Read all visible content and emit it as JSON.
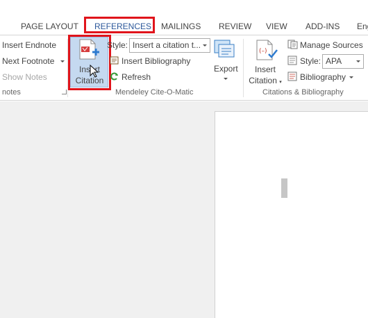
{
  "tabs": [
    {
      "label": "PAGE LAYOUT"
    },
    {
      "label": "REFERENCES"
    },
    {
      "label": "MAILINGS"
    },
    {
      "label": "REVIEW"
    },
    {
      "label": "VIEW"
    },
    {
      "label": "ADD-INS"
    },
    {
      "label": "Eng"
    }
  ],
  "footnotes": {
    "insert_endnote": "Insert Endnote",
    "next_footnote": "Next Footnote",
    "show_notes": "Show Notes",
    "group_label": "notes"
  },
  "mendeley": {
    "insert_citation_line1": "Insert",
    "insert_citation_line2": "Citation",
    "style_label": "Style:",
    "style_value": "Insert a citation t...",
    "insert_bibliography": "Insert Bibliography",
    "refresh": "Refresh",
    "export": "Export",
    "group_label": "Mendeley Cite-O-Matic"
  },
  "citations": {
    "insert_citation_line1": "Insert",
    "insert_citation_line2": "Citation",
    "manage_sources": "Manage Sources",
    "style_label": "Style:",
    "style_value": "APA",
    "bibliography": "Bibliography",
    "group_label": "Citations & Bibliography"
  },
  "colors": {
    "accent": "#2b579a",
    "highlight": "#e0141b",
    "selected_button": "#c5d9f0"
  }
}
